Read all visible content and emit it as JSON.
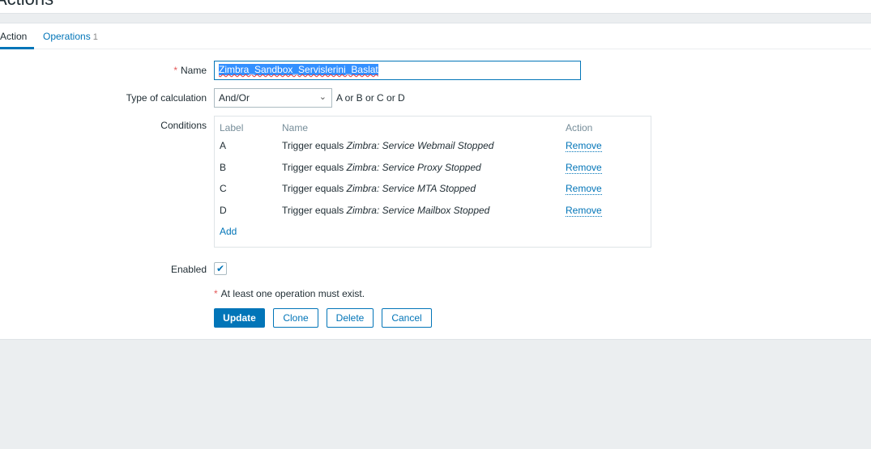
{
  "page": {
    "title": "Actions"
  },
  "tabs": [
    {
      "label": "Action"
    },
    {
      "label": "Operations",
      "count": "1"
    }
  ],
  "form": {
    "name_label": "Name",
    "name_value": "Zimbra_Sandbox_Servislerini_Baslat",
    "required_mark": "*",
    "calc_label": "Type of calculation",
    "calc_value": "And/Or",
    "calc_formula": "A or B or C or D",
    "conditions_label": "Conditions",
    "conditions_headers": [
      "Label",
      "Name",
      "Action"
    ],
    "conditions": [
      {
        "label": "A",
        "prefix": "Trigger equals",
        "target": "Zimbra: Service Webmail Stopped",
        "action": "Remove"
      },
      {
        "label": "B",
        "prefix": "Trigger equals",
        "target": "Zimbra: Service Proxy Stopped",
        "action": "Remove"
      },
      {
        "label": "C",
        "prefix": "Trigger equals",
        "target": "Zimbra: Service MTA Stopped",
        "action": "Remove"
      },
      {
        "label": "D",
        "prefix": "Trigger equals",
        "target": "Zimbra: Service Mailbox Stopped",
        "action": "Remove"
      }
    ],
    "add_label": "Add",
    "enabled_label": "Enabled",
    "enabled": true,
    "note": "At least one operation must exist."
  },
  "buttons": {
    "update": "Update",
    "clone": "Clone",
    "delete": "Delete",
    "cancel": "Cancel"
  }
}
